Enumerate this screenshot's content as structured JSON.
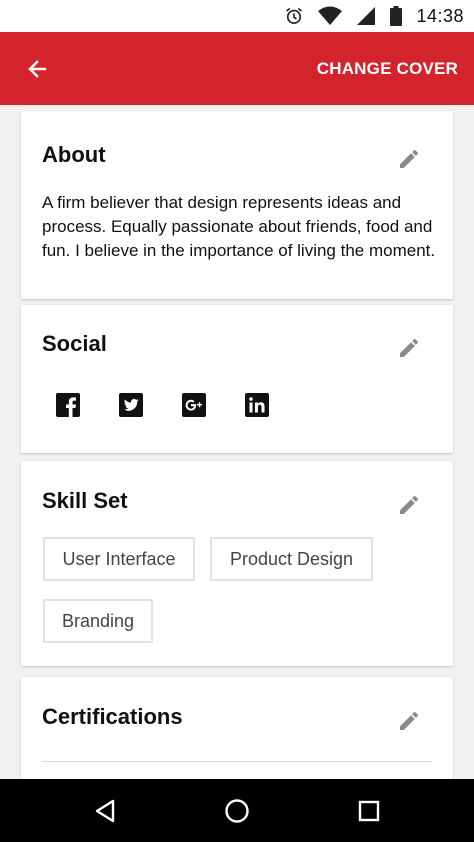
{
  "status_bar": {
    "time": "14:38",
    "icons": [
      "alarm-icon",
      "wifi-icon",
      "signal-icon",
      "battery-icon"
    ]
  },
  "app_bar": {
    "background": "#d3242e",
    "back_icon": "arrow-left-icon",
    "action_label": "CHANGE COVER"
  },
  "about": {
    "title": "About",
    "text": "A firm believer that design represents ideas and process. Equally passionate about friends, food and fun. I believe in the importance of living the moment.",
    "edit_icon": "pencil-icon"
  },
  "social": {
    "title": "Social",
    "edit_icon": "pencil-icon",
    "networks": [
      "facebook-icon",
      "twitter-icon",
      "google-plus-icon",
      "linkedin-icon"
    ]
  },
  "skills": {
    "title": "Skill Set",
    "edit_icon": "pencil-icon",
    "items": [
      "User Interface",
      "Product Design",
      "Branding"
    ]
  },
  "certifications": {
    "title": "Certifications",
    "edit_icon": "pencil-icon"
  },
  "nav_bar": {
    "buttons": [
      "back-triangle-icon",
      "home-circle-icon",
      "recents-square-icon"
    ]
  }
}
